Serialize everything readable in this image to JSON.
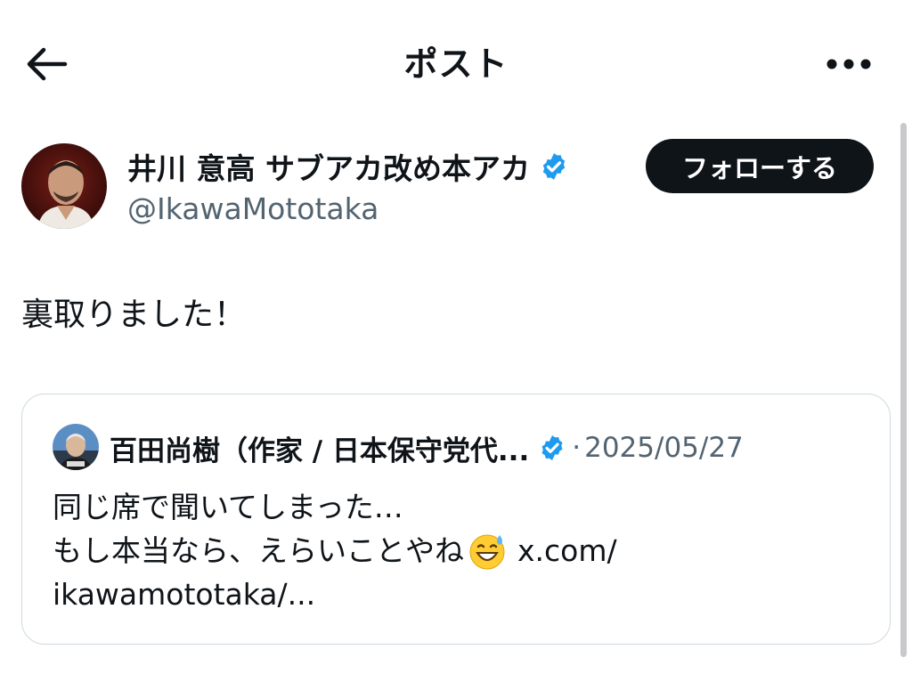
{
  "header": {
    "title": "ポスト",
    "back_icon": "back-arrow-icon",
    "more_icon": "more-horizontal-icon"
  },
  "author": {
    "display_name": "井川 意高 サブアカ改め本アカ",
    "handle": "@IkawaMototaka",
    "verified": true,
    "follow_label": "フォローする"
  },
  "post": {
    "text": "裏取りました！"
  },
  "quoted_post": {
    "author_name": "百田尚樹（作家 / 日本保守党代...",
    "verified": true,
    "separator": "·",
    "date": "2025/05/27",
    "line1": "同じ席で聞いてしまった…",
    "line2_text": "もし本当なら、えらいことやね",
    "emoji": "grinning-sweat-emoji",
    "line2_link": "x.com/",
    "line3_link": "ikawamototaka/..."
  },
  "colors": {
    "text": "#0f1419",
    "secondary": "#536471",
    "verified": "#1d9bf0",
    "border": "#cfd9de",
    "button_bg": "#0f1419",
    "button_text": "#ffffff"
  }
}
